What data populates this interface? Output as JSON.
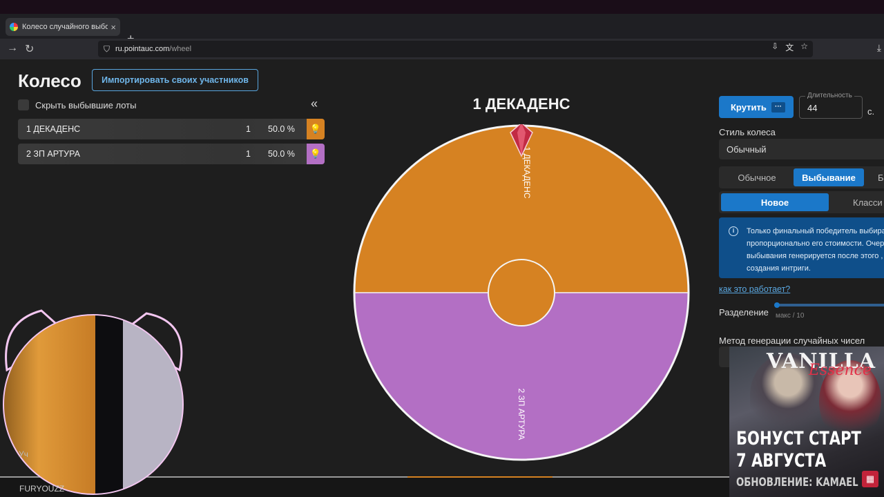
{
  "browser": {
    "tab_title": "Колесо случайного выбора – ",
    "tab_close": "×",
    "new_tab": "+",
    "tab_menu": "⌄",
    "url_host": "ru.pointauc.com",
    "url_path": "/wheel"
  },
  "header": {
    "title": "Колесо",
    "import_button": "Импортировать своих участников"
  },
  "lots_panel": {
    "hide_label": "Скрыть выбывшие лоты",
    "collapse_icon": "«",
    "lots": [
      {
        "name": "1 ДЕКАДЕНС",
        "amount": "1",
        "percent": "50.0 %",
        "color": "#d68222"
      },
      {
        "name": "2 ЗП АРТУРА",
        "amount": "1",
        "percent": "50.0 %",
        "color": "#b36fc4"
      }
    ]
  },
  "wheel": {
    "winner": "1 ДЕКАДЕНС",
    "segments": [
      {
        "label": "1 ДЕКАДЕНС",
        "share": 0.5,
        "color": "#d68222"
      },
      {
        "label": "2 ЗП АРТУРА",
        "share": 0.5,
        "color": "#b36fc4"
      }
    ]
  },
  "settings": {
    "spin_button": "Крутить",
    "spin_dots": "···",
    "duration_label": "Длительность",
    "duration_value": "44",
    "duration_unit": "с.",
    "style_label": "Стиль колеса",
    "style_value": "Обычный",
    "mode_options": [
      "Обычное",
      "Выбывание",
      "Б"
    ],
    "mode_selected": "Выбывание",
    "variant_options": [
      "Новое",
      "Класси"
    ],
    "variant_selected": "Новое",
    "info_lines": [
      "Только финальный победитель выбира",
      "пропорционально его стоимости. Очер",
      "выбывания генерируется после этого ,",
      "создания интриги."
    ],
    "how_link": "как это работает?",
    "split_label": "Разделение",
    "split_hint": "макс / 10",
    "rng_label": "Метод генерации случайных чисел"
  },
  "overlay": {
    "ad_brand": "VANILLA",
    "ad_brand_script": "Essence",
    "ad_line1": "БОНУСТ СТАРТ",
    "ad_line2": "7 АВГУСТА",
    "ad_line3": "ОБНОВЛЕНИЕ: KAMAEL",
    "webcam_name": "FURYOUZZ",
    "webcam_partial": "Уч"
  }
}
